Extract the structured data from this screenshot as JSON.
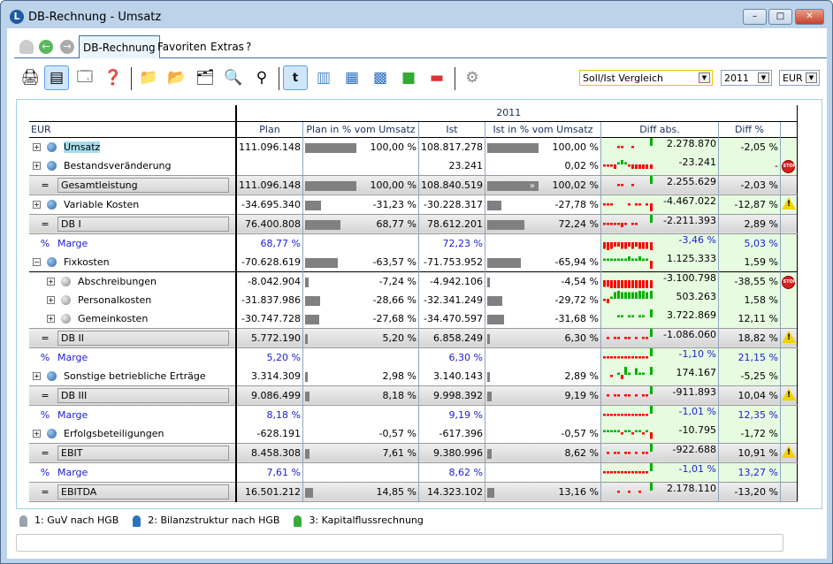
{
  "window": {
    "title": "DB-Rechnung - Umsatz",
    "logo": "L"
  },
  "menu": {
    "active_tab": "DB-Rechnung",
    "items": [
      "Favoriten",
      "Extras",
      "?"
    ]
  },
  "toolbar": {
    "icons": [
      "printer-icon",
      "report-view-icon",
      "export-view-icon",
      "help-icon",
      "folder-icon",
      "folder-upload-icon",
      "folder-settings-icon",
      "folder-search-icon",
      "binoculars-icon",
      "table-text-icon",
      "grid-col-icon",
      "grid-cols-icon",
      "grid-full-icon",
      "grid-green-icon",
      "grid-red-icon",
      "gears-icon"
    ],
    "view_select": "Soll/Ist Vergleich",
    "year_select": "2011",
    "currency_select": "EUR"
  },
  "table": {
    "year": "2011",
    "headers": {
      "label": "EUR",
      "plan": "Plan",
      "plan_pct": "Plan in % vom Umsatz",
      "ist": "Ist",
      "ist_pct": "Ist in % vom Umsatz",
      "diff_abs": "Diff abs.",
      "diff_pct": "Diff %"
    },
    "rows": [
      {
        "sym": "+",
        "label": "Umsatz",
        "kind": "item",
        "plan": "111.096.148",
        "plan_pct": "100,00 %",
        "plan_bar": 100,
        "ist": "108.817.278",
        "ist_pct": "100,00 %",
        "ist_bar": 100,
        "diff": "2.278.870",
        "diff_pct": "-2,05 %",
        "spark": [
          0,
          0,
          0,
          0,
          -1,
          -1,
          0,
          0,
          -1,
          0,
          0,
          0,
          0,
          4
        ],
        "highlight": true
      },
      {
        "sym": "+",
        "label": "Bestandsveränderung",
        "kind": "item",
        "plan": "",
        "plan_pct": "",
        "plan_bar": 0,
        "ist": "23.241",
        "ist_pct": "0,02 %",
        "ist_bar": 0,
        "diff": "-23.241",
        "diff_pct": "-",
        "spark": [
          -1,
          -1,
          -1,
          -2,
          1,
          2,
          1,
          -1,
          -2,
          -2,
          -2,
          -2,
          -2,
          -2
        ],
        "status": "stop"
      },
      {
        "sym": "=",
        "label": "Gesamtleistung",
        "kind": "sum",
        "plan": "111.096.148",
        "plan_pct": "100,00 %",
        "plan_bar": 100,
        "ist": "108.840.519",
        "ist_pct": "100,02 %",
        "ist_bar": 100,
        "ist_overflow": "»",
        "diff": "2.255.629",
        "diff_pct": "-2,03 %",
        "spark": [
          0,
          0,
          0,
          0,
          -1,
          -1,
          0,
          0,
          -1,
          0,
          0,
          0,
          0,
          4
        ]
      },
      {
        "sym": "+",
        "label": "Variable Kosten",
        "kind": "item",
        "plan": "-34.695.340",
        "plan_pct": "-31,23 %",
        "plan_bar": 31,
        "ist": "-30.228.317",
        "ist_pct": "-27,78 %",
        "ist_bar": 28,
        "diff": "-4.467.022",
        "diff_pct": "-12,87 %",
        "spark": [
          -1,
          -1,
          -1,
          0,
          0,
          0,
          0,
          -1,
          0,
          -1,
          -1,
          0,
          -1,
          -5
        ],
        "status": "warning"
      },
      {
        "sym": "=",
        "label": "DB I",
        "kind": "sum",
        "plan": "76.400.808",
        "plan_pct": "68,77 %",
        "plan_bar": 69,
        "ist": "78.612.201",
        "ist_pct": "72,24 %",
        "ist_bar": 72,
        "diff": "-2.211.393",
        "diff_pct": "2,89 %",
        "spark": [
          -1,
          -1,
          -1,
          -1,
          -1,
          -2,
          -1,
          0,
          -1,
          -1,
          0,
          0,
          0,
          4
        ]
      },
      {
        "sym": "%",
        "label": "Marge",
        "kind": "marge",
        "plan": "68,77 %",
        "ist": "72,23 %",
        "diff": "-3,46 %",
        "diff_pct": "5,03 %",
        "spark": [
          -3,
          -4,
          -3,
          -2,
          -2,
          -3,
          -3,
          -2,
          -3,
          -2,
          -3,
          -3,
          -3,
          -5
        ]
      },
      {
        "sym": "-",
        "label": "Fixkosten",
        "kind": "item",
        "plan": "-70.628.619",
        "plan_pct": "-63,57 %",
        "plan_bar": 64,
        "ist": "-71.753.952",
        "ist_pct": "-65,94 %",
        "ist_bar": 66,
        "diff": "1.125.333",
        "diff_pct": "1,59 %",
        "spark": [
          1,
          1,
          1,
          1,
          1,
          1,
          1,
          2,
          1,
          1,
          2,
          1,
          1,
          -4
        ],
        "underline": true
      },
      {
        "sym": "+",
        "label": "Abschreibungen",
        "kind": "child",
        "plan": "-8.042.904",
        "plan_pct": "-7,24 %",
        "plan_bar": 7,
        "ist": "-4.942.106",
        "ist_pct": "-4,54 %",
        "ist_bar": 4,
        "diff": "-3.100.798",
        "diff_pct": "-38,55 %",
        "spark": [
          -3,
          -3,
          -4,
          -4,
          -4,
          -5,
          -5,
          -5,
          -5,
          -5,
          -5,
          -5,
          -5,
          -5
        ],
        "status": "stop"
      },
      {
        "sym": "+",
        "label": "Personalkosten",
        "kind": "child",
        "plan": "-31.837.986",
        "plan_pct": "-28,66 %",
        "plan_bar": 29,
        "ist": "-32.341.249",
        "ist_pct": "-29,72 %",
        "ist_bar": 30,
        "diff": "503.263",
        "diff_pct": "1,58 %",
        "spark": [
          -1,
          -2,
          1,
          3,
          4,
          3,
          3,
          3,
          3,
          3,
          4,
          4,
          3,
          4
        ]
      },
      {
        "sym": "+",
        "label": "Gemeinkosten",
        "kind": "child",
        "plan": "-30.747.728",
        "plan_pct": "-27,68 %",
        "plan_bar": 28,
        "ist": "-34.470.597",
        "ist_pct": "-31,68 %",
        "ist_bar": 32,
        "diff": "3.722.869",
        "diff_pct": "12,11 %",
        "spark": [
          0,
          0,
          0,
          0,
          1,
          1,
          0,
          1,
          1,
          0,
          1,
          1,
          0,
          4
        ]
      },
      {
        "sym": "=",
        "label": "DB II",
        "kind": "sum",
        "plan": "5.772.190",
        "plan_pct": "5,20 %",
        "plan_bar": 5,
        "ist": "6.858.249",
        "ist_pct": "6,30 %",
        "ist_bar": 6,
        "diff": "-1.086.060",
        "diff_pct": "18,82 %",
        "spark": [
          0,
          -1,
          0,
          -1,
          -1,
          0,
          -1,
          -1,
          0,
          -1,
          0,
          -1,
          -1,
          4
        ],
        "status": "warning"
      },
      {
        "sym": "%",
        "label": "Marge",
        "kind": "marge",
        "plan": "5,20 %",
        "ist": "6,30 %",
        "diff": "-1,10 %",
        "diff_pct": "21,15 %",
        "spark": [
          -1,
          -1,
          -1,
          -1,
          -1,
          -1,
          -1,
          -1,
          -1,
          -1,
          -1,
          -1,
          -1,
          4
        ]
      },
      {
        "sym": "+",
        "label": "Sonstige betriebliche Erträge",
        "kind": "item",
        "plan": "3.314.309",
        "plan_pct": "2,98 %",
        "plan_bar": 3,
        "ist": "3.140.143",
        "ist_pct": "2,89 %",
        "ist_bar": 3,
        "diff": "174.167",
        "diff_pct": "-5,25 %",
        "spark": [
          0,
          0,
          -1,
          0,
          1,
          -2,
          4,
          1,
          0,
          3,
          1,
          1,
          0,
          4
        ]
      },
      {
        "sym": "=",
        "label": "DB III",
        "kind": "sum",
        "plan": "9.086.499",
        "plan_pct": "8,18 %",
        "plan_bar": 8,
        "ist": "9.998.392",
        "ist_pct": "9,19 %",
        "ist_bar": 9,
        "diff": "-911.893",
        "diff_pct": "10,04 %",
        "spark": [
          0,
          -1,
          0,
          -1,
          -1,
          0,
          -1,
          -1,
          0,
          -1,
          0,
          -1,
          -1,
          4
        ],
        "status": "warning"
      },
      {
        "sym": "%",
        "label": "Marge",
        "kind": "marge",
        "plan": "8,18 %",
        "ist": "9,19 %",
        "diff": "-1,01 %",
        "diff_pct": "12,35 %",
        "spark": [
          -1,
          -1,
          -1,
          -1,
          -1,
          -1,
          -1,
          -1,
          -1,
          -1,
          -1,
          -1,
          -1,
          4
        ]
      },
      {
        "sym": "+",
        "label": "Erfolgsbeteiligungen",
        "kind": "item",
        "plan": "-628.191",
        "plan_pct": "-0,57 %",
        "plan_bar": 0,
        "ist": "-617.396",
        "ist_pct": "-0,57 %",
        "ist_bar": 0,
        "diff": "-10.795",
        "diff_pct": "-1,72 %",
        "spark": [
          1,
          1,
          1,
          1,
          1,
          -1,
          1,
          1,
          -1,
          1,
          1,
          -1,
          1,
          -3
        ]
      },
      {
        "sym": "=",
        "label": "EBIT",
        "kind": "sum",
        "plan": "8.458.308",
        "plan_pct": "7,61 %",
        "plan_bar": 8,
        "ist": "9.380.996",
        "ist_pct": "8,62 %",
        "ist_bar": 9,
        "diff": "-922.688",
        "diff_pct": "10,91 %",
        "spark": [
          0,
          -1,
          0,
          -1,
          -1,
          0,
          -1,
          -1,
          0,
          -1,
          0,
          -1,
          -1,
          4
        ],
        "status": "warning"
      },
      {
        "sym": "%",
        "label": "Marge",
        "kind": "marge",
        "plan": "7,61 %",
        "ist": "8,62 %",
        "diff": "-1,01 %",
        "diff_pct": "13,27 %",
        "spark": [
          -1,
          -1,
          -1,
          -1,
          -1,
          -1,
          -1,
          -1,
          -1,
          -1,
          -1,
          -1,
          -1,
          4
        ]
      },
      {
        "sym": "=",
        "label": "EBITDA",
        "kind": "sum",
        "plan": "16.501.212",
        "plan_pct": "14,85 %",
        "plan_bar": 15,
        "ist": "14.323.102",
        "ist_pct": "13,16 %",
        "ist_bar": 13,
        "diff": "2.178.110",
        "diff_pct": "-13,20 %",
        "spark": [
          0,
          0,
          0,
          0,
          -1,
          0,
          0,
          -1,
          0,
          0,
          -1,
          0,
          0,
          4
        ]
      }
    ]
  },
  "bottom_tabs": [
    {
      "label": "1: GuV nach HGB",
      "color": "#9aa4ae"
    },
    {
      "label": "2: Bilanzstruktur nach HGB",
      "color": "#2a72c0"
    },
    {
      "label": "3: Kapitalflussrechnung",
      "color": "#3aaa3a"
    }
  ],
  "colors": {
    "positive": "#00b000",
    "negative": "#ff0000",
    "diff_bg": "#e6fbe0",
    "bar": "#808080",
    "marge": "#2020d0"
  }
}
